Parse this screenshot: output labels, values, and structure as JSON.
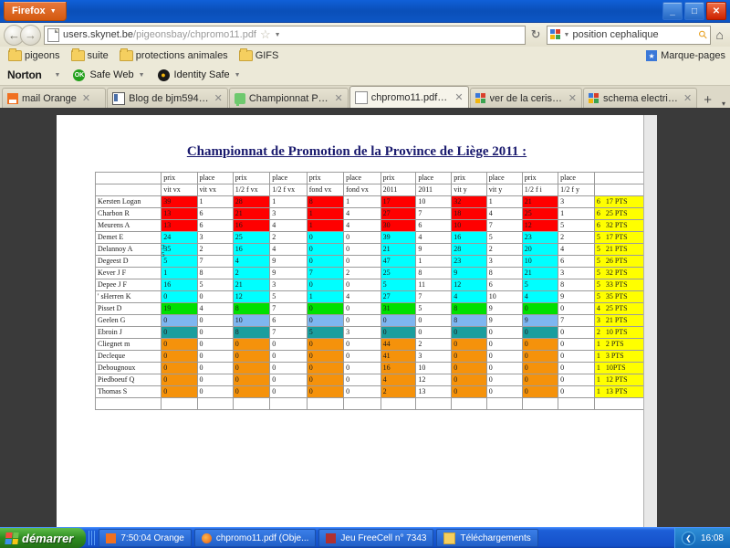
{
  "window": {
    "firefox_button": "Firefox",
    "minimize": "_",
    "maximize": "□",
    "close": "✕"
  },
  "navbar": {
    "back": "←",
    "forward": "→",
    "url_prefix": "users.skynet.be",
    "url_path": "/pigeonsbay/chpromo11.pdf",
    "star": "☆",
    "reload": "↻",
    "search_value": "position cephalique",
    "home": "⌂"
  },
  "bookmarks": {
    "items": [
      "pigeons",
      "suite",
      "protections animales",
      "GIFS"
    ],
    "right_label": "Marque-pages"
  },
  "norton": {
    "title": "Norton",
    "items": [
      "Safe Web",
      "Identity Safe"
    ],
    "ok_badge": "OK",
    "id_badge": "●"
  },
  "tabs": [
    {
      "label": "mail Orange",
      "icon": "orange-mail-favicon",
      "active": false
    },
    {
      "label": "Blog de bjm59494 - C...",
      "icon": "blog-favicon",
      "active": false
    },
    {
      "label": "Championnat Provinci...",
      "icon": "green-favicon",
      "active": false
    },
    {
      "label": "chpromo11.pdf (Objet...",
      "icon": "pdf-favicon",
      "active": true
    },
    {
      "label": "ver de la cerise - Rech...",
      "icon": "google-favicon",
      "active": false
    },
    {
      "label": "schema electrique - R...",
      "icon": "google-favicon",
      "active": false
    }
  ],
  "tab_controls": {
    "new_tab": "+",
    "list": "▾"
  },
  "document": {
    "title": "Championnat de Promotion de la Province de Liège 2011 :",
    "header_row1": [
      "",
      "prix",
      "place",
      "prix",
      "place",
      "prix",
      "place",
      "prix",
      "place",
      "prix",
      "place",
      "prix",
      "place",
      ""
    ],
    "header_row2": [
      "",
      "vit   vx",
      "vit   vx",
      "1/2 f  vx",
      "1/2 f vx",
      "fond  vx",
      "fond vx",
      "2011",
      "2011",
      "vit  y",
      "vit  y",
      "1/2 f  i",
      "1/2 f  y",
      ""
    ],
    "ghost_marks": [
      "3",
      "5"
    ],
    "rows": [
      {
        "name": "Kersten Logan",
        "color": "red",
        "values": [
          "39",
          "1",
          "28",
          "1",
          "8",
          "1",
          "17",
          "10",
          "32",
          "1",
          "21",
          "3"
        ],
        "rank": "6",
        "pts": "17 PTS"
      },
      {
        "name": "Charbon    R",
        "color": "red",
        "values": [
          "13",
          "6",
          "21",
          "3",
          "1",
          "4",
          "27",
          "7",
          "18",
          "4",
          "25",
          "1"
        ],
        "rank": "6",
        "pts": "25 PTS"
      },
      {
        "name": "Meurens   A",
        "color": "red",
        "values": [
          "13",
          "6",
          "16",
          "4",
          "1",
          "4",
          "30",
          "6",
          "10",
          "7",
          "12",
          "5"
        ],
        "rank": "6",
        "pts": "32 PTS"
      },
      {
        "name": "Demet     E",
        "color": "cyan",
        "values": [
          "24",
          "3",
          "25",
          "2",
          "0",
          "0",
          "39",
          "4",
          "16",
          "5",
          "23",
          "2"
        ],
        "rank": "5",
        "pts": "17 PTS"
      },
      {
        "name": "Delannoy   A",
        "color": "cyan",
        "values": [
          "35",
          "2",
          "16",
          "4",
          "0",
          "0",
          "21",
          "9",
          "28",
          "2",
          "20",
          "4"
        ],
        "rank": "5",
        "pts": "21 PTS",
        "tall": true
      },
      {
        "name": "Degeest   D",
        "color": "cyan",
        "values": [
          "5",
          "7",
          "4",
          "9",
          "0",
          "0",
          "47",
          "1",
          "23",
          "3",
          "10",
          "6"
        ],
        "rank": "5",
        "pts": "26 PTS"
      },
      {
        "name": "Kever   J F",
        "color": "cyan",
        "values": [
          "1",
          "8",
          "2",
          "9",
          "7",
          "2",
          "25",
          "8",
          "9",
          "8",
          "21",
          "3"
        ],
        "rank": "5",
        "pts": "32 PTS"
      },
      {
        "name": "Depee  J F",
        "color": "cyan",
        "values": [
          "16",
          "5",
          "21",
          "3",
          "0",
          "0",
          "5",
          "11",
          "12",
          "6",
          "5",
          "8"
        ],
        "rank": "5",
        "pts": "33 PTS"
      },
      {
        "name": "' sHerren  K",
        "color": "cyan",
        "values": [
          "0",
          "0",
          "12",
          "5",
          "1",
          "4",
          "27",
          "7",
          "4",
          "10",
          "4",
          "9"
        ],
        "rank": "5",
        "pts": "35 PTS"
      },
      {
        "name": "Pisset   D",
        "color": "green",
        "values": [
          "19",
          "4",
          "8",
          "7",
          "0",
          "0",
          "31",
          "5",
          "8",
          "9",
          "0",
          "0"
        ],
        "rank": "4",
        "pts": "25 PTS"
      },
      {
        "name": "Geelen   G",
        "color": "lblue",
        "values": [
          "0",
          "0",
          "10",
          "6",
          "0",
          "0",
          "0",
          "0",
          "8",
          "9",
          "9",
          "7"
        ],
        "rank": "3",
        "pts": "21 PTS"
      },
      {
        "name": "Ebroin    J",
        "color": "teal",
        "values": [
          "0",
          "0",
          "8",
          "7",
          "5",
          "3",
          "0",
          "0",
          "0",
          "0",
          "0",
          "0"
        ],
        "rank": "2",
        "pts": "10 PTS"
      },
      {
        "name": "Cliegnet   m",
        "color": "orange",
        "values": [
          "0",
          "0",
          "0",
          "0",
          "0",
          "0",
          "44",
          "2",
          "0",
          "0",
          "0",
          "0"
        ],
        "rank": "1",
        "pts": "2 PTS"
      },
      {
        "name": "Decleque",
        "color": "orange",
        "values": [
          "0",
          "0",
          "0",
          "0",
          "0",
          "0",
          "41",
          "3",
          "0",
          "0",
          "0",
          "0"
        ],
        "rank": "1",
        "pts": "3 PTS"
      },
      {
        "name": "Debougnoux",
        "color": "orange",
        "values": [
          "0",
          "0",
          "0",
          "0",
          "0",
          "0",
          "16",
          "10",
          "0",
          "0",
          "0",
          "0"
        ],
        "rank": "1",
        "pts": "10PTS"
      },
      {
        "name": "Piedboeuf  Q",
        "color": "orange",
        "values": [
          "0",
          "0",
          "0",
          "0",
          "0",
          "0",
          "4",
          "12",
          "0",
          "0",
          "0",
          "0"
        ],
        "rank": "1",
        "pts": "12 PTS"
      },
      {
        "name": "Thomas    S",
        "color": "orange",
        "values": [
          "0",
          "0",
          "0",
          "0",
          "0",
          "0",
          "2",
          "13",
          "0",
          "0",
          "0",
          "0"
        ],
        "rank": "1",
        "pts": "13 PTS"
      }
    ],
    "colors": {
      "red": "#ff0000",
      "cyan": "#00ffff",
      "green": "#00e000",
      "lblue": "#7eb6f0",
      "teal": "#1a9e9e",
      "orange": "#f5920b",
      "points": "#ffff00",
      "title": "#1a1a6e"
    }
  },
  "taskbar": {
    "start_label": "démarrer",
    "buttons": [
      {
        "label": "7:50:04 Orange",
        "icon": "orange-icon"
      },
      {
        "label": "chpromo11.pdf (Obje...",
        "icon": "firefox-icon"
      },
      {
        "label": "Jeu FreeCell n° 7343",
        "icon": "freecell-icon"
      },
      {
        "label": "Téléchargements",
        "icon": "folder-icon"
      }
    ],
    "clock": "16:08",
    "tray_arrow": "❮"
  }
}
